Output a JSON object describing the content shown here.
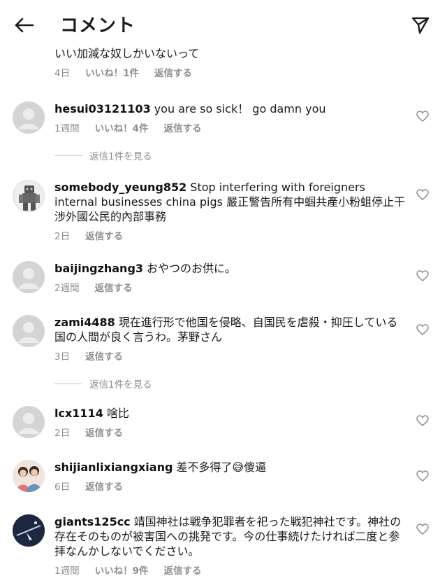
{
  "header": {
    "title": "コメント"
  },
  "top_comment": {
    "text": "いい加減な奴しかいないって",
    "time": "4日",
    "likes": "いいね！1件",
    "reply": "返信する"
  },
  "comments": [
    {
      "username": "hesui03121103",
      "text": "you are so sick！ go damn you",
      "time": "1週間",
      "likes": "いいね！4件",
      "reply": "返信する",
      "view_replies": "返信1件を見る"
    },
    {
      "username": "somebody_yeung852",
      "text": "Stop interfering with foreigners internal businesses china pigs 嚴正警告所有中蝈共產小粉蛆停止干涉外國公民的內部事務",
      "time": "2日",
      "reply": "返信する"
    },
    {
      "username": "baijingzhang3",
      "text": "おやつのお供に。",
      "time": "2週間",
      "reply": "返信する"
    },
    {
      "username": "zami4488",
      "text": "現在進行形で他国を侵略、自国民を虐殺・抑圧している国の人間が良く言うわ。茅野さん",
      "time": "3日",
      "reply": "返信する",
      "view_replies": "返信1件を見る"
    },
    {
      "username": "lcx1114",
      "text": "啥比",
      "time": "2日",
      "reply": "返信する"
    },
    {
      "username": "shijianlixiangxiang",
      "text": "差不多得了😅傻逼",
      "time": "6日",
      "reply": "返信する"
    },
    {
      "username": "giants125cc",
      "text": "靖国神社は戦争犯罪者を祀った戦犯神社です。神社の存在そのものが被害国への挑発です。今の仕事続けたければ二度と参拝なんかしないでください。",
      "time": "1週間",
      "likes": "いいね！9件",
      "reply": "返信する"
    }
  ],
  "colors": {
    "meta_gray": "#8e8e8e",
    "text": "#1a1a1a",
    "avatar_default": "#d4d4d4"
  }
}
